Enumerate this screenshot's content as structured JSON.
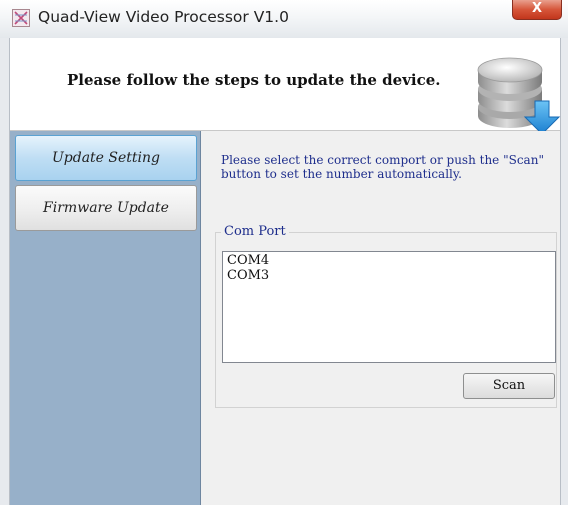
{
  "window": {
    "title": "Quad-View Video Processor V1.0",
    "close_label": "X"
  },
  "header": {
    "text": "Please follow the steps to update the device.",
    "icon": "database-download-icon"
  },
  "sidebar": {
    "items": [
      {
        "label": "Update Setting",
        "active": true
      },
      {
        "label": "Firmware Update",
        "active": false
      }
    ]
  },
  "content": {
    "instruction": "Please select the correct comport or push the \"Scan\" button to set the number automatically.",
    "com_port": {
      "label": "Com Port",
      "items": [
        "COM4",
        "COM3"
      ]
    },
    "scan_label": "Scan"
  },
  "colors": {
    "sidebar_bg": "#97b0c9",
    "active_nav": "#bfdef4",
    "instruction_text": "#1e2e8c",
    "close_button": "#d6563a"
  }
}
